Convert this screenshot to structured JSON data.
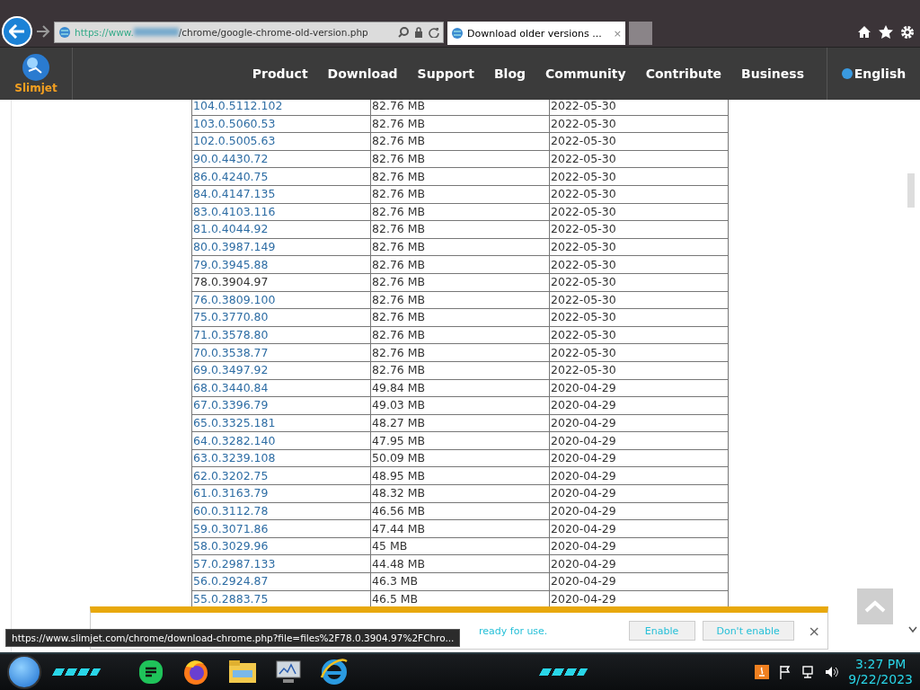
{
  "browser": {
    "url_prefix": "https://www.",
    "url_path": "/chrome/google-chrome-old-version.php",
    "tab_title": "Download older versions ...",
    "tab_close": "×"
  },
  "site": {
    "logo_text": "Slimjet",
    "nav": [
      "Product",
      "Download",
      "Support",
      "Blog",
      "Community",
      "Contribute",
      "Business"
    ],
    "language": "English"
  },
  "table": {
    "rows": [
      {
        "version": "104.0.5112.102",
        "size": "82.76 MB",
        "date": "2022-05-30",
        "hovered": false
      },
      {
        "version": "103.0.5060.53",
        "size": "82.76 MB",
        "date": "2022-05-30",
        "hovered": false
      },
      {
        "version": "102.0.5005.63",
        "size": "82.76 MB",
        "date": "2022-05-30",
        "hovered": false
      },
      {
        "version": "90.0.4430.72",
        "size": "82.76 MB",
        "date": "2022-05-30",
        "hovered": false
      },
      {
        "version": "86.0.4240.75",
        "size": "82.76 MB",
        "date": "2022-05-30",
        "hovered": false
      },
      {
        "version": "84.0.4147.135",
        "size": "82.76 MB",
        "date": "2022-05-30",
        "hovered": false
      },
      {
        "version": "83.0.4103.116",
        "size": "82.76 MB",
        "date": "2022-05-30",
        "hovered": false
      },
      {
        "version": "81.0.4044.92",
        "size": "82.76 MB",
        "date": "2022-05-30",
        "hovered": false
      },
      {
        "version": "80.0.3987.149",
        "size": "82.76 MB",
        "date": "2022-05-30",
        "hovered": false
      },
      {
        "version": "79.0.3945.88",
        "size": "82.76 MB",
        "date": "2022-05-30",
        "hovered": false
      },
      {
        "version": "78.0.3904.97",
        "size": "82.76 MB",
        "date": "2022-05-30",
        "hovered": true
      },
      {
        "version": "76.0.3809.100",
        "size": "82.76 MB",
        "date": "2022-05-30",
        "hovered": false
      },
      {
        "version": "75.0.3770.80",
        "size": "82.76 MB",
        "date": "2022-05-30",
        "hovered": false
      },
      {
        "version": "71.0.3578.80",
        "size": "82.76 MB",
        "date": "2022-05-30",
        "hovered": false
      },
      {
        "version": "70.0.3538.77",
        "size": "82.76 MB",
        "date": "2022-05-30",
        "hovered": false
      },
      {
        "version": "69.0.3497.92",
        "size": "82.76 MB",
        "date": "2022-05-30",
        "hovered": false
      },
      {
        "version": "68.0.3440.84",
        "size": "49.84 MB",
        "date": "2020-04-29",
        "hovered": false
      },
      {
        "version": "67.0.3396.79",
        "size": "49.03 MB",
        "date": "2020-04-29",
        "hovered": false
      },
      {
        "version": "65.0.3325.181",
        "size": "48.27 MB",
        "date": "2020-04-29",
        "hovered": false
      },
      {
        "version": "64.0.3282.140",
        "size": "47.95 MB",
        "date": "2020-04-29",
        "hovered": false
      },
      {
        "version": "63.0.3239.108",
        "size": "50.09 MB",
        "date": "2020-04-29",
        "hovered": false
      },
      {
        "version": "62.0.3202.75",
        "size": "48.95 MB",
        "date": "2020-04-29",
        "hovered": false
      },
      {
        "version": "61.0.3163.79",
        "size": "48.32 MB",
        "date": "2020-04-29",
        "hovered": false
      },
      {
        "version": "60.0.3112.78",
        "size": "46.56 MB",
        "date": "2020-04-29",
        "hovered": false
      },
      {
        "version": "59.0.3071.86",
        "size": "47.44 MB",
        "date": "2020-04-29",
        "hovered": false
      },
      {
        "version": "58.0.3029.96",
        "size": "45 MB",
        "date": "2020-04-29",
        "hovered": false
      },
      {
        "version": "57.0.2987.133",
        "size": "44.48 MB",
        "date": "2020-04-29",
        "hovered": false
      },
      {
        "version": "56.0.2924.87",
        "size": "46.3 MB",
        "date": "2020-04-29",
        "hovered": false
      },
      {
        "version": "55.0.2883.75",
        "size": "46.5 MB",
        "date": "2020-04-29",
        "hovered": false
      }
    ]
  },
  "notification": {
    "message": "ready for use.",
    "buttons": [
      "Enable",
      "Don't enable"
    ],
    "close": "×"
  },
  "status_tooltip": "https://www.slimjet.com/chrome/download-chrome.php?file=files%2F78.0.3904.97%2FChro...",
  "taskbar": {
    "time": "3:27 PM",
    "date": "9/22/2023"
  }
}
